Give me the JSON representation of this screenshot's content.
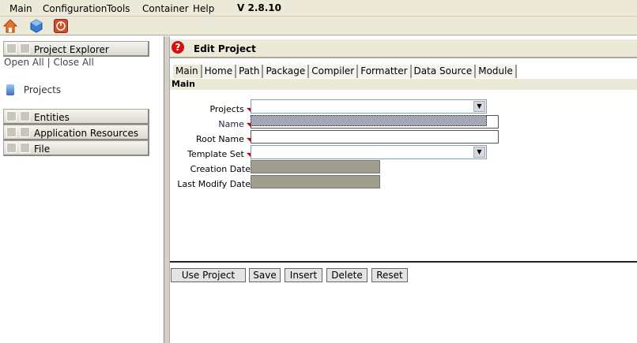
{
  "menubar": {
    "items": [
      "Main",
      "Configuration",
      "Tools",
      "Container",
      "Help"
    ],
    "version": "V 2.8.10"
  },
  "toolbar": {
    "icons": [
      "home-icon",
      "database-icon",
      "power-icon"
    ]
  },
  "sidebar": {
    "project_explorer": "Project Explorer",
    "open_all": "Open All",
    "separator": "|",
    "close_all": "Close All",
    "projects": "Projects",
    "sections": [
      "Entities",
      "Application Resources",
      "File"
    ]
  },
  "editor": {
    "title": "Edit Project",
    "tabs": [
      "Main",
      "Home",
      "Path",
      "Package",
      "Compiler",
      "Formatter",
      "Data Source",
      "Module"
    ],
    "section": "Main",
    "fields": {
      "projects": "Projects",
      "name": "Name",
      "root_name": "Root Name",
      "template_set": "Template Set",
      "creation_date": "Creation Date",
      "last_modify_date": "Last Modify Date"
    },
    "values": {
      "projects": "",
      "name": "",
      "root_name": "",
      "template_set": "",
      "creation_date": "",
      "last_modify_date": ""
    },
    "buttons": {
      "use_project": "Use Project",
      "save": "Save",
      "insert": "Insert",
      "delete": "Delete",
      "reset": "Reset"
    }
  },
  "colors": {
    "chrome": "#ece9d8",
    "readonly": "#a09e8c",
    "required": "#cc0000"
  }
}
